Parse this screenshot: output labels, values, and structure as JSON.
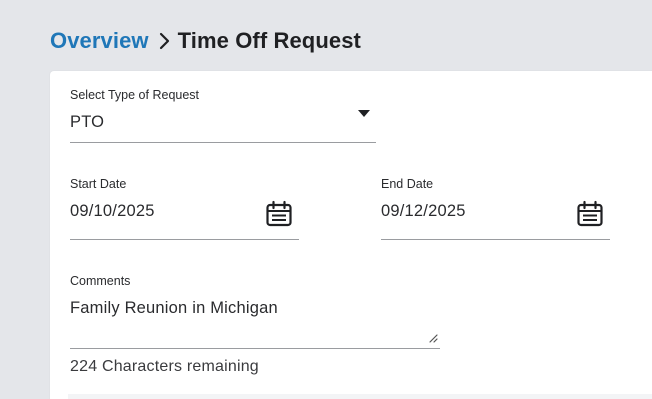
{
  "breadcrumb": {
    "parent": "Overview",
    "current": "Time Off Request"
  },
  "form": {
    "request_type": {
      "label": "Select Type of Request",
      "value": "PTO"
    },
    "start_date": {
      "label": "Start Date",
      "value": "09/10/2025"
    },
    "end_date": {
      "label": "End Date",
      "value": "09/12/2025"
    },
    "comments": {
      "label": "Comments",
      "value": "Family Reunion in Michigan",
      "chars_remaining": "224 Characters remaining"
    }
  },
  "colors": {
    "accent": "#1f77b8",
    "background": "#e4e6ea",
    "card": "#ffffff"
  }
}
